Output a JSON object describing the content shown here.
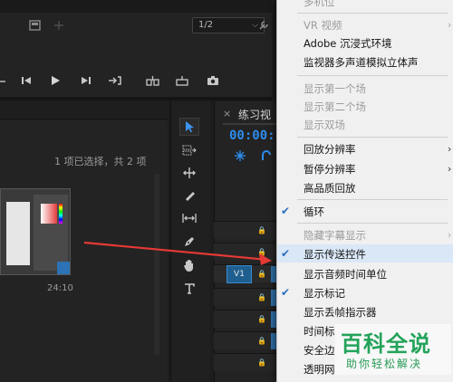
{
  "monitor": {
    "zoom_value": "1/2",
    "zoom_caret": "⌵"
  },
  "project": {
    "selection_status": "1 项已选择，共 2 项",
    "clip_duration": "24:10"
  },
  "timeline": {
    "tab_close": "×",
    "tab_title": "练习视",
    "timecode": "00:00:",
    "track_label": "V1",
    "lock_glyph": "🔒"
  },
  "context_menu": {
    "items": [
      {
        "label": "多机位",
        "enabled": false,
        "checked": false,
        "submenu": false
      },
      {
        "label": "VR 视频",
        "enabled": false,
        "checked": false,
        "submenu": true
      },
      {
        "label": "Adobe 沉浸式环境",
        "enabled": true,
        "checked": false,
        "submenu": false
      },
      {
        "label": "监视器多声道模拟立体声",
        "enabled": true,
        "checked": false,
        "submenu": false
      },
      {
        "label": "显示第一个场",
        "enabled": false,
        "checked": false,
        "submenu": false
      },
      {
        "label": "显示第二个场",
        "enabled": false,
        "checked": false,
        "submenu": false
      },
      {
        "label": "显示双场",
        "enabled": false,
        "checked": false,
        "submenu": false
      },
      {
        "label": "回放分辨率",
        "enabled": true,
        "checked": false,
        "submenu": true
      },
      {
        "label": "暂停分辨率",
        "enabled": true,
        "checked": false,
        "submenu": true
      },
      {
        "label": "高品质回放",
        "enabled": true,
        "checked": false,
        "submenu": false
      },
      {
        "label": "循环",
        "enabled": true,
        "checked": true,
        "submenu": false
      },
      {
        "label": "隐藏字幕显示",
        "enabled": false,
        "checked": false,
        "submenu": true
      },
      {
        "label": "显示传送控件",
        "enabled": true,
        "checked": true,
        "submenu": false
      },
      {
        "label": "显示音频时间单位",
        "enabled": true,
        "checked": false,
        "submenu": false
      },
      {
        "label": "显示标记",
        "enabled": true,
        "checked": true,
        "submenu": false
      },
      {
        "label": "显示丢帧指示器",
        "enabled": true,
        "checked": false,
        "submenu": false
      },
      {
        "label": "时间标",
        "enabled": true,
        "checked": false,
        "submenu": false
      },
      {
        "label": "安全边",
        "enabled": true,
        "checked": false,
        "submenu": false
      },
      {
        "label": "透明网",
        "enabled": true,
        "checked": false,
        "submenu": false
      }
    ],
    "check_glyph": "✔",
    "submenu_glyph": "›"
  },
  "watermark": {
    "main": "百科全说",
    "sub": "助你轻松解决"
  },
  "colors": {
    "accent": "#2d8ceb",
    "arrow": "#e53935",
    "watermark": "#23a35a"
  }
}
